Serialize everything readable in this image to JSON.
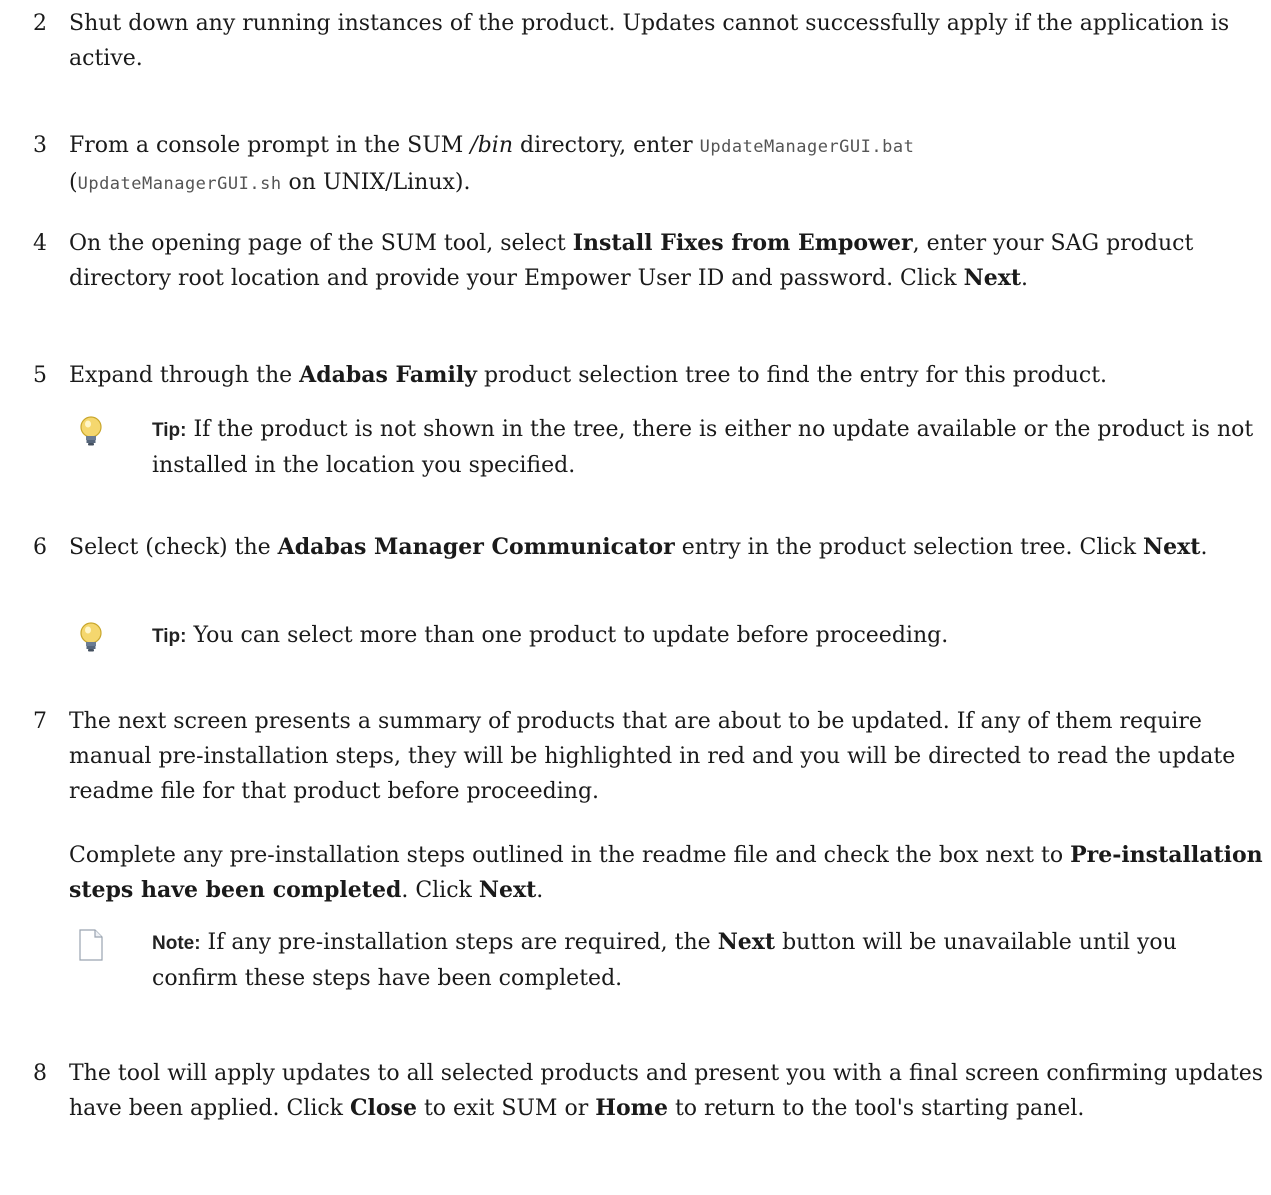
{
  "steps": [
    {
      "num": "2",
      "text": "Shut down any running instances of the product. Updates cannot successfully apply if the application is active."
    },
    {
      "num": "3",
      "t1": "From a console prompt in the SUM ",
      "t1_em": "/bin",
      "t2": " directory, enter ",
      "code1": "UpdateManagerGUI.bat",
      "t3": "(",
      "code2": "UpdateManagerGUI.sh",
      "t4": " on UNIX/Linux)."
    },
    {
      "num": "4",
      "t1": "On the opening page of the SUM tool, select ",
      "b1": "Install Fixes from Empower",
      "t2": ", enter your SAG product directory root location and provide your Empower User ID and password. Click ",
      "b2": "Next",
      "t3": "."
    },
    {
      "num": "5",
      "t1": "Expand through the ",
      "b1": "Adabas Family",
      "t2": " product selection tree to find the entry for this product.",
      "tip_label": "Tip:",
      "tip_text": " If the product is not shown in the tree, there is either no update available or the product is not installed in the location you specified."
    },
    {
      "num": "6",
      "t1": "Select (check) the ",
      "b1": "Adabas Manager Communicator",
      "t2": " entry in the product selection tree. Click ",
      "b2": "Next",
      "t3": ".",
      "tip_label": "Tip:",
      "tip_text": " You can select more than one product to update before proceeding."
    },
    {
      "num": "7",
      "p1": "The next screen presents a summary of products that are about to be updated. If any of them require manual pre-installation steps, they will be highlighted in red and you will be directed to read the update readme file for that product before proceeding.",
      "p2_t1": "Complete any pre-installation steps outlined in the readme file and check the box next to ",
      "p2_b1": "Pre-installation steps have been completed",
      "p2_t2": ". Click ",
      "p2_b2": "Next",
      "p2_t3": ".",
      "note_label": "Note:",
      "note_t1": " If any pre-installation steps are required, the ",
      "note_b1": "Next",
      "note_t2": " button will be unavailable until you confirm these steps have been completed."
    },
    {
      "num": "8",
      "t1": "The tool will apply updates to all selected products and present you with a final screen confirming updates have been applied. Click ",
      "b1": "Close",
      "t2": " to exit SUM or ",
      "b2": "Home",
      "t3": " to return to the tool's starting panel."
    }
  ],
  "icons": {
    "tip": "lightbulb-icon",
    "note": "page-icon",
    "tip_bulb_color": "#f5d76e",
    "tip_base_color": "#6b7c93"
  }
}
